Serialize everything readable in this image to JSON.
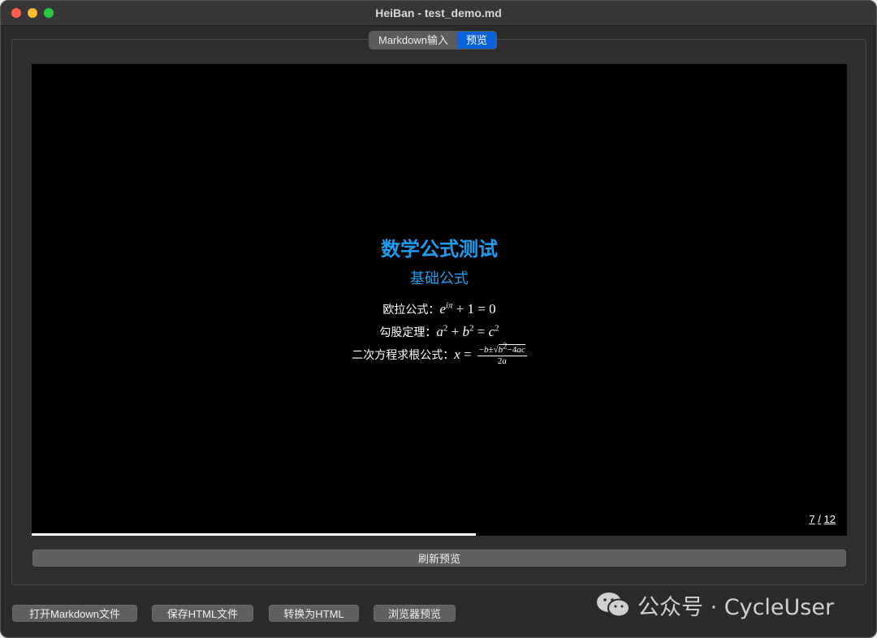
{
  "window": {
    "title": "HeiBan - test_demo.md"
  },
  "tabs": [
    {
      "label": "Markdown输入",
      "active": false
    },
    {
      "label": "预览",
      "active": true
    }
  ],
  "slide": {
    "heading": "数学公式测试",
    "subheading": "基础公式",
    "formulas": {
      "euler_label": "欧拉公式：",
      "pythagoras_label": "勾股定理：",
      "quadratic_label": "二次方程求根公式："
    },
    "page_current": "7",
    "page_separator": "/",
    "page_total": "12",
    "progress_fraction": 0.545
  },
  "refresh_label": "刷新预览",
  "bottom_buttons": {
    "open_md": "打开Markdown文件",
    "save_html": "保存HTML文件",
    "convert_html": "转换为HTML",
    "browser_preview": "浏览器预览"
  },
  "watermark": {
    "text": "公众号 · CycleUser"
  },
  "colors": {
    "accent": "#1f9cf0",
    "tab_active": "#0a63d8",
    "window_bg": "#2b2b2b"
  }
}
